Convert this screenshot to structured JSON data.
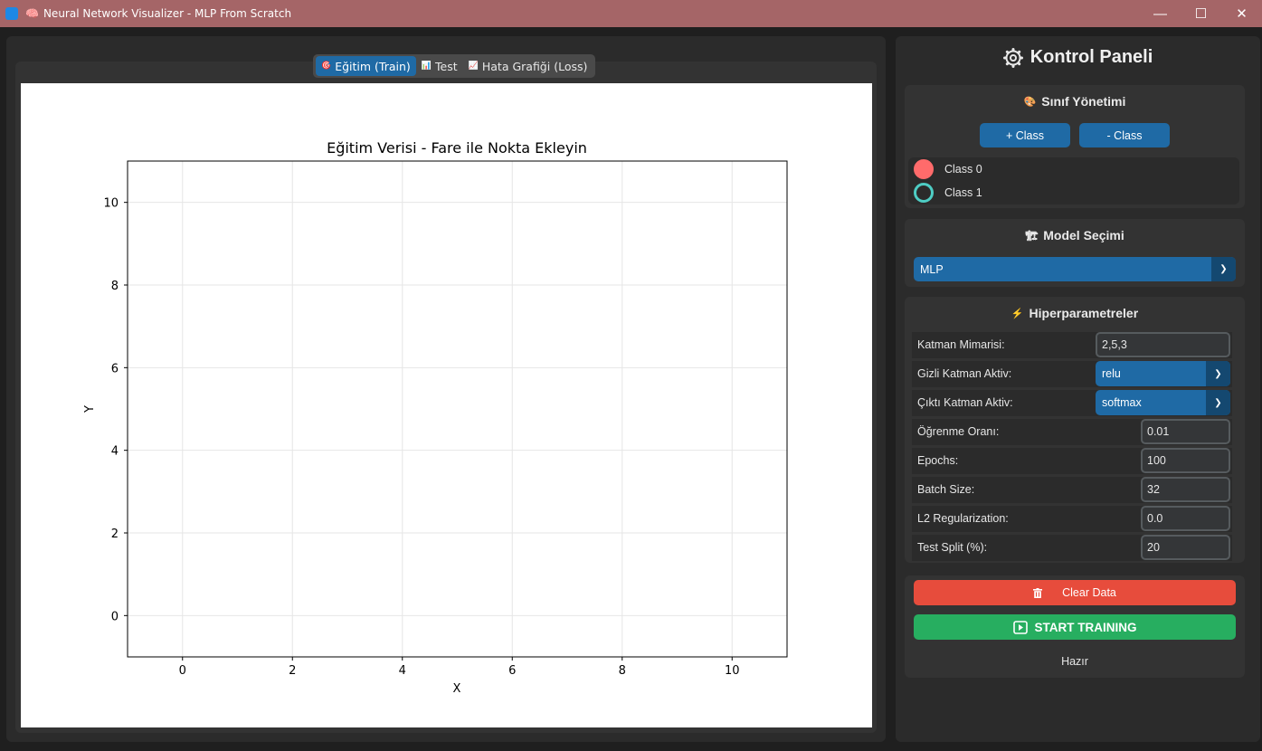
{
  "window": {
    "title": "Neural Network Visualizer - MLP From Scratch",
    "minimize": "—",
    "maximize": "☐",
    "close": "✕"
  },
  "tabs": [
    {
      "icon": "🎯",
      "label": "Eğitim (Train)",
      "active": true
    },
    {
      "icon": "📊",
      "label": "Test",
      "active": false
    },
    {
      "icon": "📈",
      "label": "Hata Grafiği (Loss)",
      "active": false
    }
  ],
  "chart_data": {
    "type": "scatter",
    "title": "Eğitim Verisi - Fare ile Nokta Ekleyin",
    "xlabel": "X",
    "ylabel": "Y",
    "xlim": [
      -1,
      11
    ],
    "ylim": [
      -1,
      11
    ],
    "xticks": [
      0,
      2,
      4,
      6,
      8,
      10
    ],
    "yticks": [
      0,
      2,
      4,
      6,
      8,
      10
    ],
    "grid": true,
    "series": []
  },
  "panel": {
    "title": "Kontrol Paneli",
    "class_section": {
      "title": "Sınıf Yönetimi",
      "add_label": "+ Class",
      "remove_label": "- Class",
      "classes": [
        {
          "label": "Class 0",
          "color": "#ff6b6b"
        },
        {
          "label": "Class 1",
          "color": "#4ecdc4"
        }
      ]
    },
    "model_section": {
      "title": "Model Seçimi",
      "selected": "MLP"
    },
    "hyper_section": {
      "title": "Hiperparametreler",
      "params": [
        {
          "label": "Katman Mimarisi:",
          "value": "2,5,3",
          "kind": "entry-wide"
        },
        {
          "label": "Gizli Katman Aktiv:",
          "value": "relu",
          "kind": "dropdown"
        },
        {
          "label": "Çıktı Katman Aktiv:",
          "value": "softmax",
          "kind": "dropdown"
        },
        {
          "label": "Öğrenme Oranı:",
          "value": "0.01",
          "kind": "entry"
        },
        {
          "label": "Epochs:",
          "value": "100",
          "kind": "entry"
        },
        {
          "label": "Batch Size:",
          "value": "32",
          "kind": "entry"
        },
        {
          "label": "L2 Regularization:",
          "value": "0.0",
          "kind": "entry"
        },
        {
          "label": "Test Split (%):",
          "value": "20",
          "kind": "entry"
        }
      ]
    },
    "actions": {
      "clear_label": "Clear Data",
      "clear_color": "#e74c3c",
      "start_label": "START TRAINING",
      "start_color": "#27ae60",
      "status": "Hazır"
    }
  }
}
